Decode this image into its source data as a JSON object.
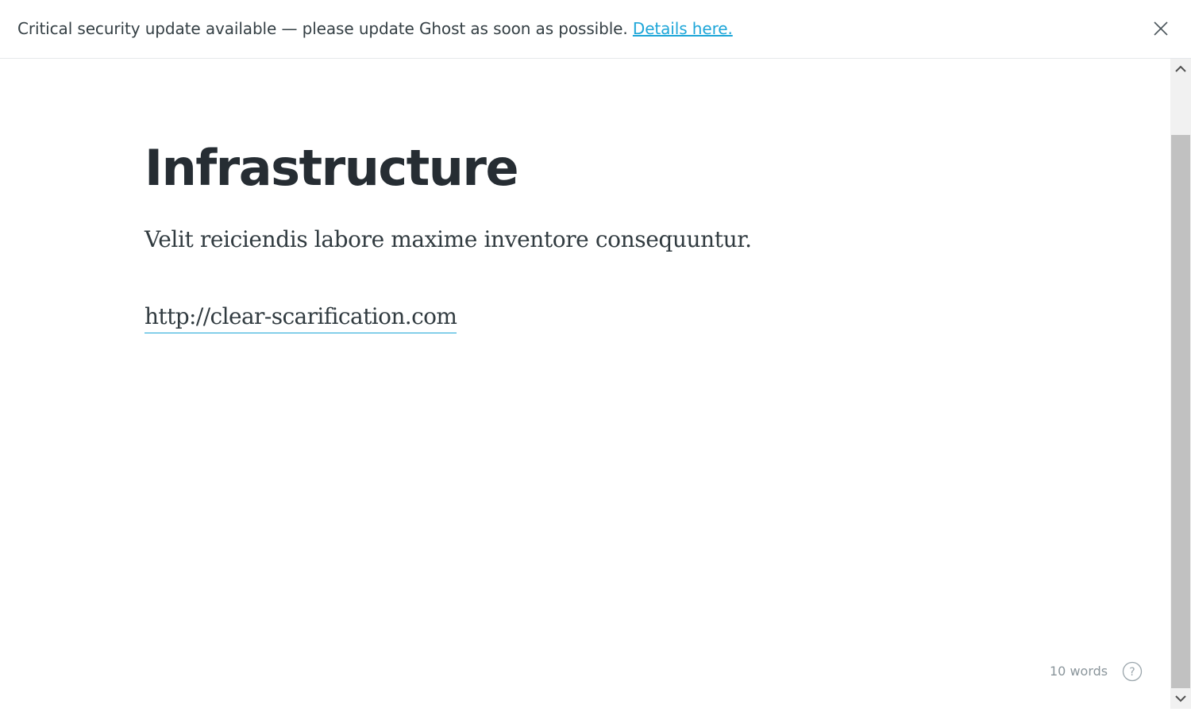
{
  "banner": {
    "message": "Critical security update available — please update Ghost as soon as possible.",
    "link_label": "Details here.",
    "link_color": "#1ea6d8",
    "close_icon": "close-icon"
  },
  "editor": {
    "title": "Infrastructure",
    "paragraph": "Velit reiciendis labore maxime inventore consequuntur.",
    "link_text": "http://clear-scarification.com"
  },
  "footer": {
    "word_count": "10 words",
    "help_icon": "help-question-icon"
  },
  "scrollbar": {
    "up_icon": "chevron-up-icon",
    "down_icon": "chevron-down-icon"
  }
}
